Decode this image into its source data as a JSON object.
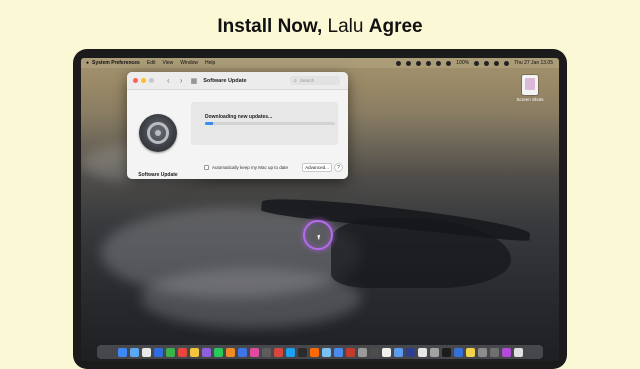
{
  "headline": {
    "part1": "Install Now,",
    "part2": "Lalu",
    "part3": "Agree"
  },
  "menubar": {
    "apple_icon": "apple-icon",
    "app_name": "System Preferences",
    "items": [
      "Edit",
      "View",
      "Window",
      "Help"
    ],
    "battery": "100%",
    "datetime": "Thu 27 Jan 13.05"
  },
  "desktop": {
    "file_label": "Screen Shots"
  },
  "window": {
    "title": "Software Update",
    "search_placeholder": "Search",
    "pane_label": "Software Update",
    "status_text": "Downloading new updates...",
    "progress": 0.06,
    "auto_update_label": "Automatically keep my Mac up to date",
    "advanced_button": "Advanced...",
    "help_button": "?"
  },
  "dock": {
    "colors": [
      "#3d88f6",
      "#5aa9f7",
      "#e9e9e9",
      "#2f6de0",
      "#3bb34a",
      "#e8453c",
      "#f3c43c",
      "#8f5fe0",
      "#29c95d",
      "#f08a24",
      "#3f74e6",
      "#e24aa0",
      "#5c5c5c",
      "#d9463b",
      "#1ea0f1",
      "#2b2b2b",
      "#ff6a00",
      "#7bc1f0",
      "#4a8bf0",
      "#c43a2f",
      "#9a9a9a",
      "#4c4c4c",
      "#f0f0f0",
      "#5b9cf1",
      "#2d3e8c",
      "#e6e6e6",
      "#a2a2a2",
      "#1c1c1c",
      "#3570d8",
      "#f0d34a",
      "#8c8c8c",
      "#6f6f6f",
      "#b34ad9",
      "#e1e1e1"
    ]
  }
}
